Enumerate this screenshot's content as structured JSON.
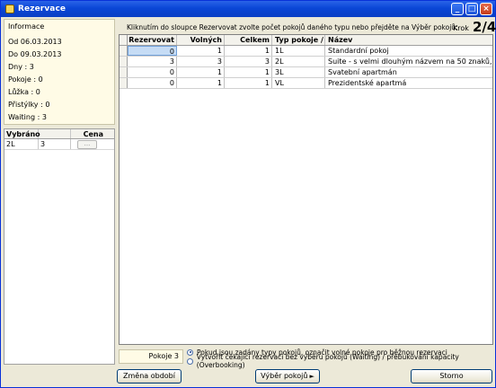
{
  "window": {
    "title": "Rezervace"
  },
  "info": {
    "heading": "Informace",
    "from": "Od 06.03.2013",
    "to": "Do 09.03.2013",
    "days": "Dny : 3",
    "rooms": "Pokoje : 0",
    "beds": "Lůžka : 0",
    "extra_beds": "Přistýlky : 0",
    "waiting": "Waiting : 3"
  },
  "selected": {
    "headers": [
      "Vybráno",
      "",
      "Cena"
    ],
    "rows": [
      {
        "type": "2L",
        "count": "3",
        "price_button": "..."
      }
    ]
  },
  "instruction": "Kliknutím do sloupce Rezervovat zvolte počet pokojů daného typu nebo přejděte na Výběr pokojů:",
  "step": {
    "label": "Krok",
    "value": "2/4"
  },
  "grid": {
    "headers": [
      "Rezervovat",
      "Volných",
      "Celkem",
      "Typ pokoje ∕",
      "Název"
    ],
    "rows": [
      {
        "reserve": "0",
        "free": "1",
        "total": "1",
        "type": "1L",
        "name": "Standardní pokoj"
      },
      {
        "reserve": "3",
        "free": "3",
        "total": "3",
        "type": "2L",
        "name": "Suite -    s velmi dlouhým názvem na 50 znaků,"
      },
      {
        "reserve": "0",
        "free": "1",
        "total": "1",
        "type": "3L",
        "name": "Svatební apartmán"
      },
      {
        "reserve": "0",
        "free": "1",
        "total": "1",
        "type": "VL",
        "name": "Prezidentské apartmá"
      }
    ]
  },
  "bottom": {
    "rooms_label": "Pokoje 3",
    "radio1": "Pokud jsou zadány typy pokojů, označit volné pokoje pro běžnou rezervaci",
    "radio2": "Vytvořit čekající rezervaci bez výběru pokojů (Waiting) / přebukování kapacity (Overbooking)",
    "btn_change": "Změna období",
    "btn_rooms": "Výběr pokojů",
    "btn_cancel": "Storno"
  }
}
